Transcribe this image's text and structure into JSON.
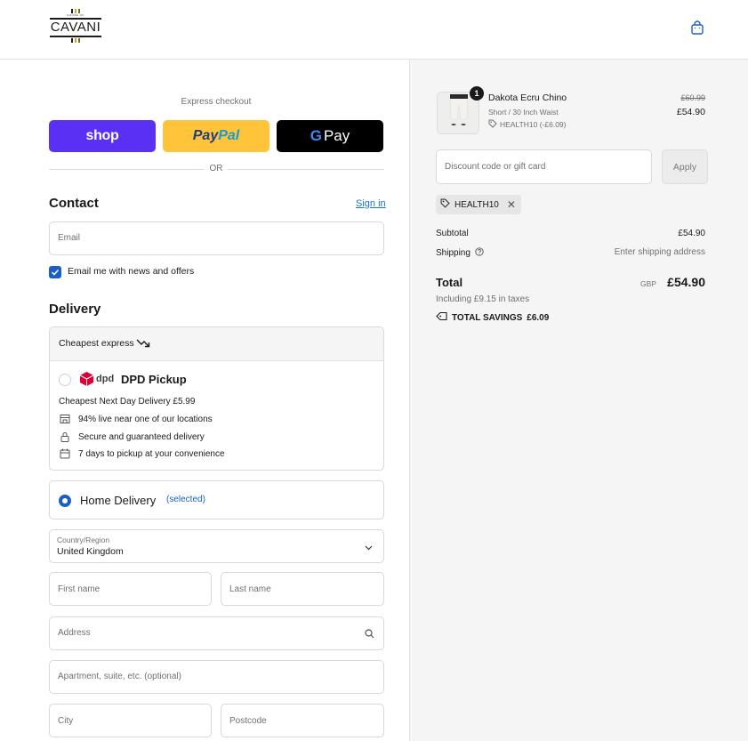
{
  "header": {
    "logo": {
      "tagline": "HOUSE OF",
      "word": "CAVANI",
      "stripe_colors": [
        "#1a1a1a",
        "#c8a82c",
        "#7a6b2a"
      ]
    },
    "cart_icon": "shopping-bag-icon"
  },
  "express": {
    "title": "Express checkout",
    "shop_label": "shop",
    "paypal_label_a": "Pay",
    "paypal_label_b": "Pal",
    "gpay_label_g": "G",
    "gpay_label": "Pay",
    "or_label": "OR"
  },
  "contact": {
    "heading": "Contact",
    "sign_in": "Sign in",
    "email_placeholder": "Email",
    "newsletter_label": "Email me with news and offers",
    "newsletter_checked": true
  },
  "delivery": {
    "heading": "Delivery",
    "group_label": "Cheapest express",
    "dpd": {
      "logo_text": "dpd",
      "title": "DPD Pickup",
      "subtitle": "Cheapest Next Day Delivery £5.99",
      "features": [
        {
          "icon": "store-icon",
          "text": "94% live near one of our locations"
        },
        {
          "icon": "lock-icon",
          "text": "Secure and guaranteed delivery"
        },
        {
          "icon": "calendar-icon",
          "text": "7 days to pickup at your convenience"
        }
      ]
    },
    "home": {
      "label": "Home Delivery",
      "selected_text": "(selected)"
    },
    "country": {
      "label": "Country/Region",
      "value": "United Kingdom"
    },
    "first_name_placeholder": "First name",
    "last_name_placeholder": "Last name",
    "address_placeholder": "Address",
    "apartment_placeholder": "Apartment, suite, etc. (optional)",
    "city_placeholder": "City",
    "postcode_placeholder": "Postcode"
  },
  "summary": {
    "item": {
      "qty": "1",
      "name": "Dakota Ecru Chino",
      "variant": "Short / 30 Inch Waist",
      "discount": "HEALTH10 (-£6.09)",
      "old_price": "£60.99",
      "price": "£54.90"
    },
    "discount_placeholder": "Discount code or gift card",
    "apply_label": "Apply",
    "applied_code": "HEALTH10",
    "subtotal_label": "Subtotal",
    "subtotal_value": "£54.90",
    "shipping_label": "Shipping",
    "shipping_value": "Enter shipping address",
    "total_label": "Total",
    "currency": "GBP",
    "total_value": "£54.90",
    "taxes": "Including £9.15 in taxes",
    "savings_label": "TOTAL SAVINGS",
    "savings_value": "£6.09"
  }
}
